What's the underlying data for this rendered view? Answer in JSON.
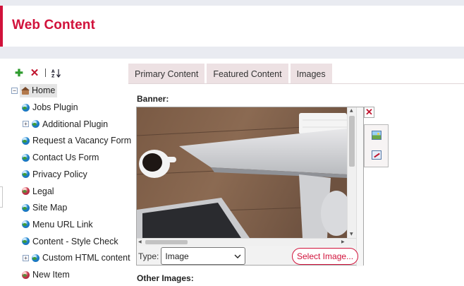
{
  "header": {
    "title": "Web Content"
  },
  "toolbar": {
    "sort_glyph": "↓"
  },
  "tree": {
    "root": "Home",
    "items": [
      {
        "label": "Jobs Plugin",
        "expandable": false,
        "icon": "globe-icon"
      },
      {
        "label": "Additional Plugin",
        "expandable": true,
        "icon": "globe-icon"
      },
      {
        "label": "Request a Vacancy Form",
        "expandable": false,
        "icon": "globe-icon"
      },
      {
        "label": "Contact Us Form",
        "expandable": false,
        "icon": "globe-icon"
      },
      {
        "label": "Privacy Policy",
        "expandable": false,
        "icon": "globe-icon"
      },
      {
        "label": "Legal",
        "expandable": false,
        "icon": "red-globe-icon"
      },
      {
        "label": "Site Map",
        "expandable": false,
        "icon": "globe-icon"
      },
      {
        "label": "Menu URL Link",
        "expandable": false,
        "icon": "globe-icon"
      },
      {
        "label": "Content - Style Check",
        "expandable": false,
        "icon": "globe-icon"
      },
      {
        "label": "Custom HTML content",
        "expandable": true,
        "icon": "globe-icon"
      },
      {
        "label": "New Item",
        "expandable": false,
        "icon": "red-globe-icon"
      }
    ]
  },
  "tabs": [
    "Primary Content",
    "Featured Content",
    "Images"
  ],
  "content": {
    "banner_label": "Banner:",
    "type_label": "Type:",
    "type_value": "Image",
    "select_image_label": "Select Image...",
    "other_images_label": "Other Images:"
  },
  "colors": {
    "accent": "#d1123b",
    "tab_bg": "#ede1e3",
    "page_bg": "#e9ebf1"
  }
}
